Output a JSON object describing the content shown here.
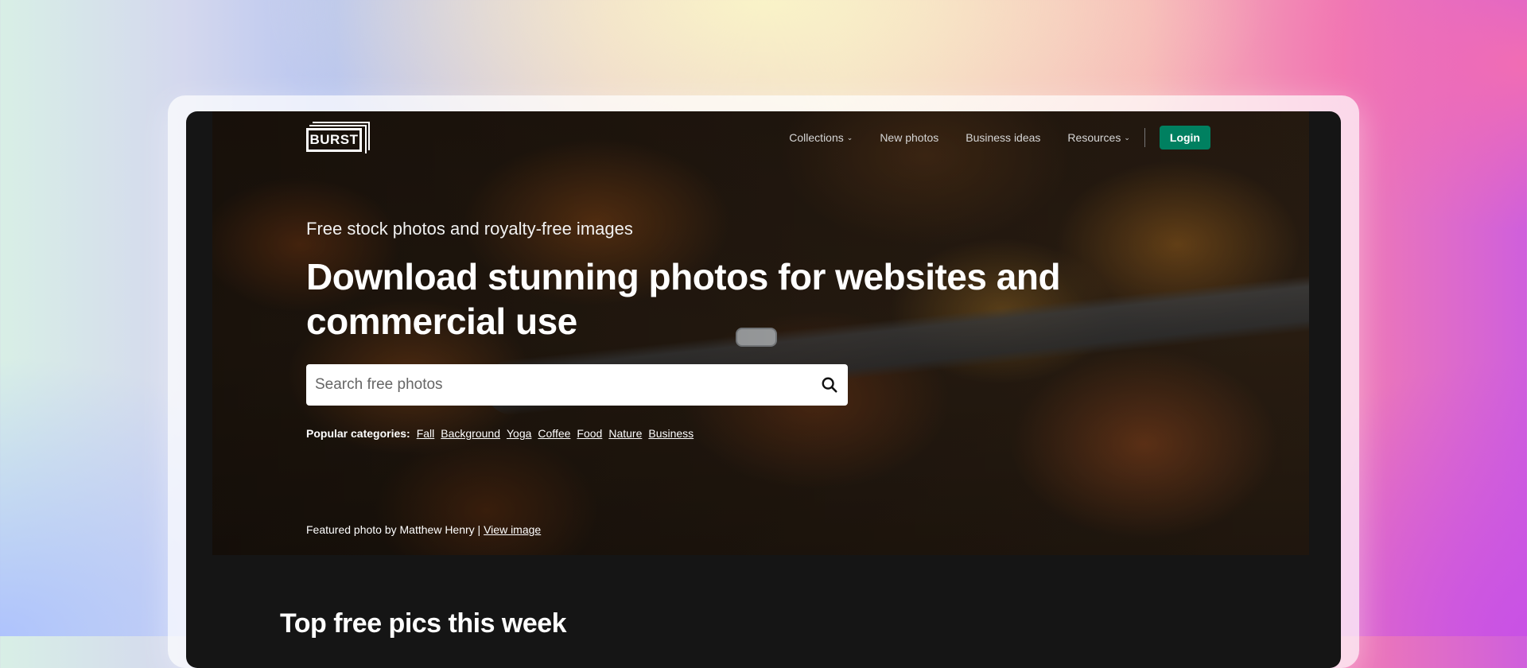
{
  "brand": {
    "logo_text": "BURST"
  },
  "nav": {
    "items": [
      {
        "label": "Collections",
        "has_dropdown": true
      },
      {
        "label": "New photos",
        "has_dropdown": false
      },
      {
        "label": "Business ideas",
        "has_dropdown": false
      },
      {
        "label": "Resources",
        "has_dropdown": true
      }
    ],
    "chevron": "⌄",
    "login_label": "Login"
  },
  "hero": {
    "subtitle": "Free stock photos and royalty-free images",
    "headline": "Download stunning photos for websites and commercial use",
    "search": {
      "placeholder": "Search free photos",
      "value": ""
    },
    "categories": {
      "label": "Popular categories:",
      "items": [
        "Fall",
        "Background",
        "Yoga",
        "Coffee",
        "Food",
        "Nature",
        "Business"
      ]
    },
    "credit": {
      "text": "Featured photo by Matthew Henry |",
      "link_label": "View image"
    }
  },
  "section": {
    "title": "Top free pics this week"
  },
  "colors": {
    "accent": "#008060",
    "screen_background": "#151515",
    "text": "#ffffff"
  },
  "icons": [
    "search-icon",
    "chevron-down-icon"
  ]
}
